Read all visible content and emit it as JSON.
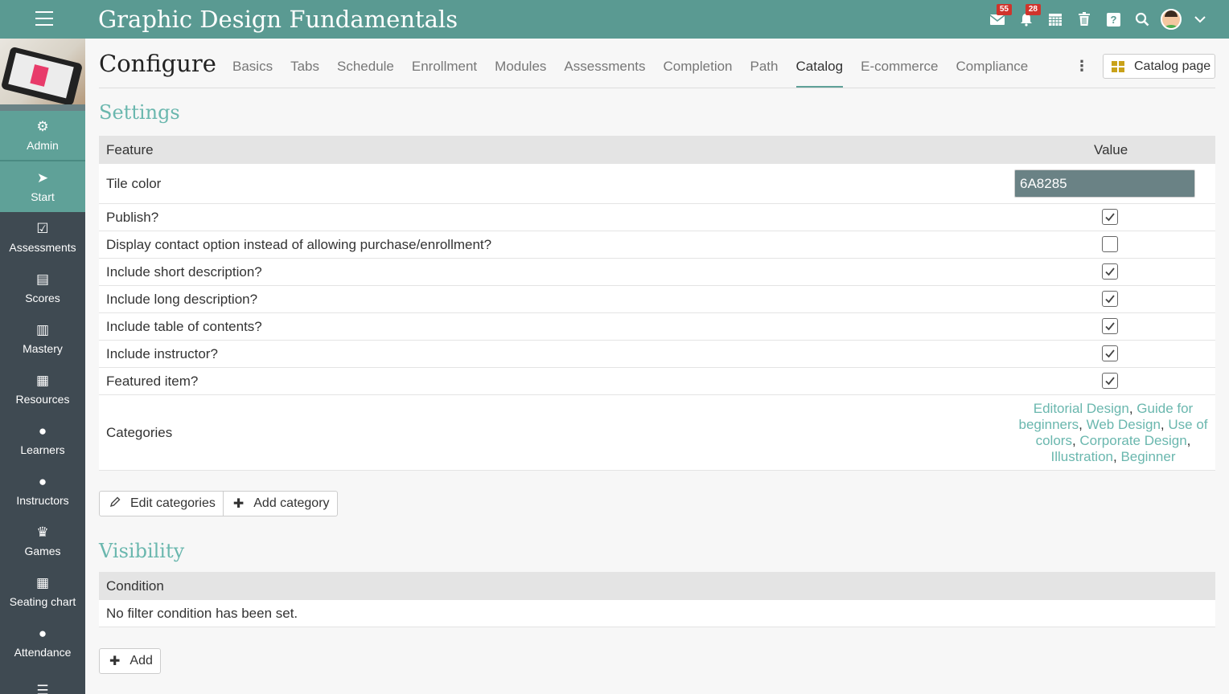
{
  "header": {
    "title": "Graphic Design Fundamentals",
    "icons": {
      "messages": {
        "name": "envelope-icon",
        "badge": "55"
      },
      "notifications": {
        "name": "bell-icon",
        "badge": "28"
      },
      "calendar": {
        "name": "calendar-icon"
      },
      "trash": {
        "name": "trash-icon"
      },
      "help": {
        "name": "help-icon"
      },
      "search": {
        "name": "search-icon"
      }
    }
  },
  "sidebar": {
    "items": [
      {
        "label": "Admin",
        "icon": "gear-icon",
        "glyph": "⚙"
      },
      {
        "label": "Start",
        "icon": "navigate-icon",
        "glyph": "➤"
      },
      {
        "label": "Assessments",
        "icon": "checklist-icon",
        "glyph": "☑"
      },
      {
        "label": "Scores",
        "icon": "gradebook-icon",
        "glyph": "▤"
      },
      {
        "label": "Mastery",
        "icon": "bar-chart-icon",
        "glyph": "▥"
      },
      {
        "label": "Resources",
        "icon": "books-icon",
        "glyph": "▦"
      },
      {
        "label": "Learners",
        "icon": "person-icon",
        "glyph": "●"
      },
      {
        "label": "Instructors",
        "icon": "instructor-icon",
        "glyph": "●"
      },
      {
        "label": "Games",
        "icon": "trophy-icon",
        "glyph": "♛"
      },
      {
        "label": "Seating chart",
        "icon": "seating-icon",
        "glyph": "▦"
      },
      {
        "label": "Attendance",
        "icon": "group-icon",
        "glyph": "●"
      },
      {
        "label": "",
        "icon": "list-icon",
        "glyph": "☰"
      }
    ]
  },
  "page": {
    "title": "Configure",
    "tabs": [
      "Basics",
      "Tabs",
      "Schedule",
      "Enrollment",
      "Modules",
      "Assessments",
      "Completion",
      "Path",
      "Catalog",
      "E-commerce",
      "Compliance"
    ],
    "active_tab": "Catalog",
    "catalog_page_label": "Catalog page"
  },
  "settings": {
    "title": "Settings",
    "col_feature": "Feature",
    "col_value": "Value",
    "tile_color_label": "Tile color",
    "tile_color_value": "6A8285",
    "tile_color_hex": "#6a8285",
    "rows": [
      {
        "label": "Publish?",
        "checked": true
      },
      {
        "label": "Display contact option instead of allowing purchase/enrollment?",
        "checked": false
      },
      {
        "label": "Include short description?",
        "checked": true
      },
      {
        "label": "Include long description?",
        "checked": true
      },
      {
        "label": "Include table of contents?",
        "checked": true
      },
      {
        "label": "Include instructor?",
        "checked": true
      },
      {
        "label": "Featured item?",
        "checked": true
      }
    ],
    "categories_label": "Categories",
    "categories": [
      "Editorial Design",
      "Guide for beginners",
      "Web Design",
      "Use of colors",
      "Corporate Design",
      "Illustration",
      "Beginner"
    ],
    "edit_categories_label": "Edit categories",
    "add_category_label": "Add category"
  },
  "visibility": {
    "title": "Visibility",
    "col_condition": "Condition",
    "empty_text": "No filter condition has been set.",
    "add_label": "Add"
  },
  "colors": {
    "topbar": "#5a9a92",
    "accent": "#6ab7ae",
    "sidebar": "#3f4a52",
    "badge": "#d0342c"
  }
}
